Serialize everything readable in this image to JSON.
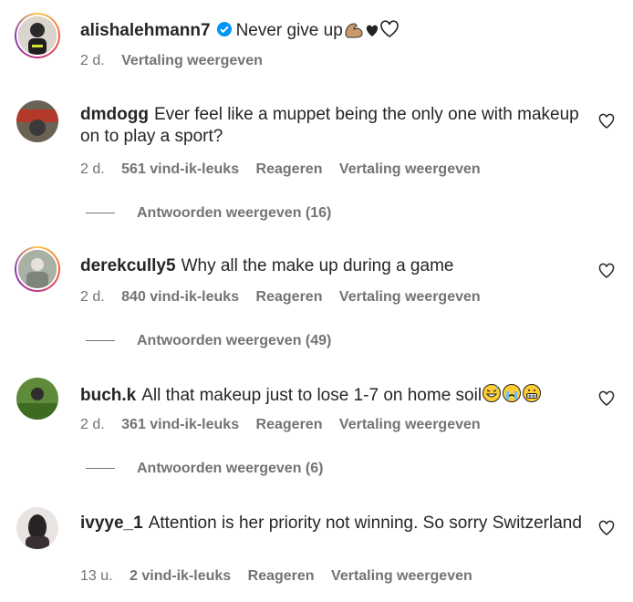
{
  "caption": {
    "username": "alishalehmann7",
    "text": "Never give up",
    "emoji_suffix": [
      "muscle-emoji",
      "heart-black",
      "heart-outline"
    ],
    "time": "2 d.",
    "translate": "Vertaling weergeven"
  },
  "comments": [
    {
      "username": "dmdogg",
      "text": "Ever feel like a muppet being the only one with makeup on to play a sport?",
      "time": "2 d.",
      "likes": "561 vind-ik-leuks",
      "reply": "Reageren",
      "translate": "Vertaling weergeven",
      "view_replies": "Antwoorden weergeven (16)"
    },
    {
      "username": "derekcully5",
      "text": "Why all the make up during a game",
      "time": "2 d.",
      "likes": "840 vind-ik-leuks",
      "reply": "Reageren",
      "translate": "Vertaling weergeven",
      "view_replies": "Antwoorden weergeven (49)"
    },
    {
      "username": "buch.k",
      "text": "All that makeup just to lose 1-7 on home soil",
      "emoji_suffix": [
        "sweat-smile-emoji",
        "crying-emoji",
        "grimace-emoji"
      ],
      "time": "2 d.",
      "likes": "361 vind-ik-leuks",
      "reply": "Reageren",
      "translate": "Vertaling weergeven",
      "view_replies": "Antwoorden weergeven (6)"
    },
    {
      "username": "ivyye_1",
      "text": "Attention is her priority not winning. So sorry Switzerland",
      "time": "13 u.",
      "likes": "2 vind-ik-leuks",
      "reply": "Reageren",
      "translate": "Vertaling weergeven"
    }
  ],
  "colors": {
    "text": "#262626",
    "muted": "#737373",
    "verified": "#0095f6"
  }
}
